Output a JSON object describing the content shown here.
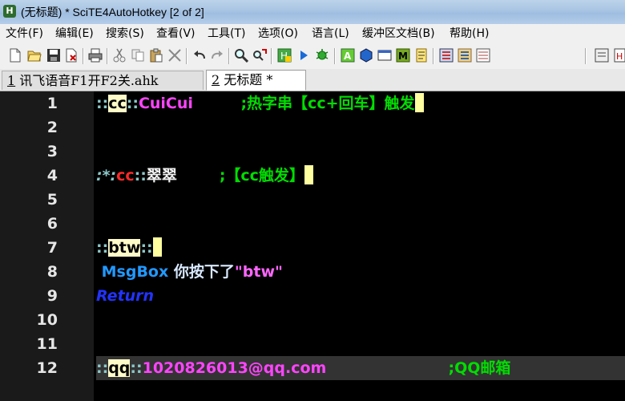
{
  "window": {
    "title": "(无标题) * SciTE4AutoHotkey [2 of 2]",
    "icon_letter": "H"
  },
  "menu": [
    {
      "label": "文件(F)"
    },
    {
      "label": "编辑(E)"
    },
    {
      "label": "搜索(S)"
    },
    {
      "label": "查看(V)"
    },
    {
      "label": "工具(T)"
    },
    {
      "label": "选项(O)"
    },
    {
      "label": "语言(L)"
    },
    {
      "label": "缓冲区文档(B)"
    },
    {
      "label": "帮助(H)"
    }
  ],
  "toolbar_icons": [
    "new-file",
    "open-folder",
    "save",
    "close-file",
    "print",
    "cut",
    "copy",
    "paste",
    "delete",
    "undo",
    "redo",
    "find",
    "replace",
    "compile",
    "run",
    "debug",
    "ahk-info",
    "object-browser",
    "window-spy",
    "macro",
    "notes",
    "settings",
    "tool-a",
    "tool-b",
    "tool-c",
    "tool-d"
  ],
  "tabs": [
    {
      "num": "1",
      "label": "讯飞语音F1开F2关.ahk"
    },
    {
      "num": "2",
      "label": "无标题 *"
    }
  ],
  "editor": {
    "line_numbers": [
      "1",
      "2",
      "3",
      "4",
      "5",
      "6",
      "7",
      "8",
      "9",
      "10",
      "11",
      "12"
    ],
    "line1": {
      "op1": "::",
      "hot": "cc",
      "op2": "::",
      "repl": "CuiCui",
      "comment": ";热字串【cc+回车】触发"
    },
    "line4": {
      "opts": ":*:",
      "hot": "cc",
      "op2": "::",
      "repl": "翠翠",
      "comment": ";【cc触发】"
    },
    "line7": {
      "op1": "::",
      "hot": "btw",
      "op2": "::"
    },
    "line8": {
      "cmd": "MsgBox",
      "text": " 你按下了",
      "str": "\"btw\""
    },
    "line9": {
      "kw": "Return"
    },
    "line12": {
      "op1": "::",
      "hot": "qq",
      "op2": "::",
      "repl": "1020826013@qq.com",
      "comment": ";QQ邮箱"
    }
  }
}
